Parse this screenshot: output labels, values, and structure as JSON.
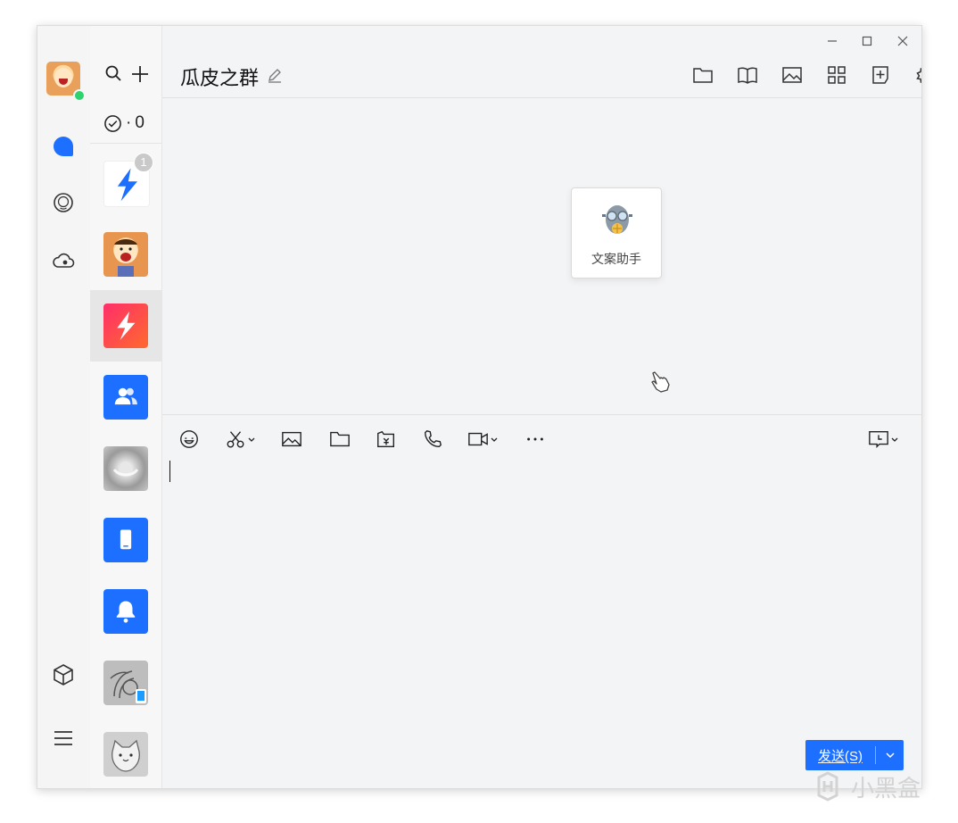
{
  "window": {
    "minimize_icon": "minimize-icon",
    "maximize_icon": "maximize-icon",
    "close_icon": "close-icon"
  },
  "nav_rail": {
    "status": "online",
    "items": [
      {
        "name": "messages",
        "icon": "chat-bubble-icon",
        "active": true
      },
      {
        "name": "contacts",
        "icon": "smiley-circle-icon"
      },
      {
        "name": "cloud",
        "icon": "cloud-icon"
      },
      {
        "name": "apps",
        "icon": "cube-icon"
      },
      {
        "name": "menu",
        "icon": "hamburger-icon"
      }
    ]
  },
  "contacts_column": {
    "todo_prefix": "·",
    "todo_count": "0",
    "chats": [
      {
        "name": "lightning-app",
        "badge": "1"
      },
      {
        "name": "user-avatar"
      },
      {
        "name": "lightning-red",
        "active": true
      },
      {
        "name": "group-contacts"
      },
      {
        "name": "blurred-photo"
      },
      {
        "name": "phone-device"
      },
      {
        "name": "notification-bell"
      },
      {
        "name": "hand-drawing"
      },
      {
        "name": "cat-sticker"
      }
    ]
  },
  "header": {
    "title": "瓜皮之群"
  },
  "message_area": {
    "helper_card_label": "文案助手"
  },
  "input": {
    "send_label": "发送(S)"
  },
  "watermark": {
    "text": "小黑盒"
  },
  "colors": {
    "accent": "#1d6fff",
    "status_online": "#2dd36f",
    "badge": "#c9c9c9"
  }
}
